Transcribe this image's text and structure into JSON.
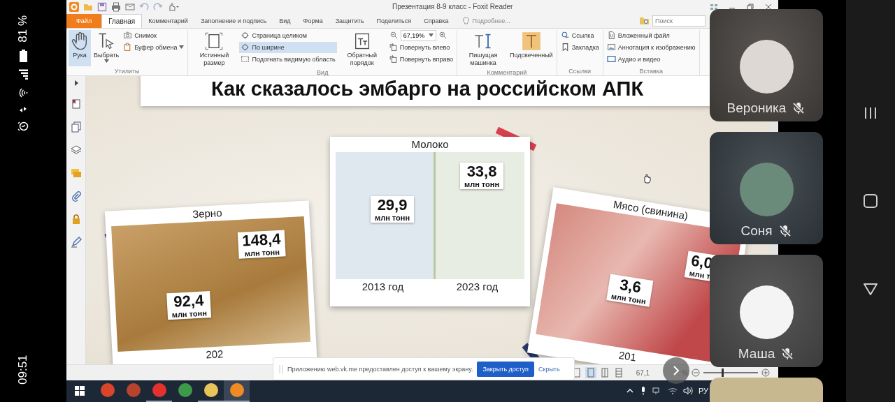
{
  "phone_status": {
    "battery": "81 %",
    "time": "09:51"
  },
  "window": {
    "title": "Презентация 8-9 класс - Foxit Reader"
  },
  "tabs": [
    {
      "kind": "file",
      "label": "Файл",
      "selected": false
    },
    {
      "kind": "tab",
      "label": "Главная",
      "selected": true
    },
    {
      "kind": "tab",
      "label": "Комментарий",
      "selected": false
    },
    {
      "kind": "tab",
      "label": "Заполнение и подпись",
      "selected": false
    },
    {
      "kind": "tab",
      "label": "Вид",
      "selected": false
    },
    {
      "kind": "tab",
      "label": "Форма",
      "selected": false
    },
    {
      "kind": "tab",
      "label": "Защитить",
      "selected": false
    },
    {
      "kind": "tab",
      "label": "Поделиться",
      "selected": false
    },
    {
      "kind": "tab",
      "label": "Справка",
      "selected": false
    }
  ],
  "tell_me": "Подробнее...",
  "search": {
    "placeholder": "Поиск"
  },
  "ribbon": [
    {
      "label": "Утилиты",
      "columns": [
        [
          {
            "kind": "large",
            "label": "Рука",
            "selected": true,
            "dropdown": false
          }
        ],
        [
          {
            "kind": "large",
            "label": "Выбрать",
            "selected": false,
            "dropdown": true
          }
        ],
        [
          {
            "kind": "small",
            "label": "Снимок",
            "selected": false,
            "dropdown": false
          },
          {
            "kind": "small",
            "label": "Буфер обмена",
            "selected": false,
            "dropdown": true
          }
        ]
      ]
    },
    {
      "label": "Вид",
      "columns": [
        [
          {
            "kind": "large",
            "label": "Истинный размер",
            "selected": false,
            "dropdown": false
          }
        ],
        [
          {
            "kind": "small",
            "label": "Страница целиком",
            "selected": false,
            "dropdown": false
          },
          {
            "kind": "small",
            "label": "По ширине",
            "selected": true,
            "dropdown": false
          },
          {
            "kind": "small",
            "label": "Подогнать видимую область",
            "selected": false,
            "dropdown": false
          }
        ],
        [
          {
            "kind": "large",
            "label": "Обратный порядок",
            "selected": false,
            "dropdown": false
          }
        ],
        [
          {
            "kind": "zoom",
            "value": "67,19%"
          },
          {
            "kind": "small",
            "label": "Повернуть влево",
            "selected": false,
            "dropdown": false
          },
          {
            "kind": "small",
            "label": "Повернуть вправо",
            "selected": false,
            "dropdown": false
          }
        ]
      ]
    },
    {
      "label": "Комментарий",
      "columns": [
        [
          {
            "kind": "large",
            "label": "Пишущая машинка",
            "selected": false,
            "dropdown": false
          }
        ],
        [
          {
            "kind": "large",
            "label": "Подсвеченный",
            "selected": false,
            "dropdown": false
          }
        ]
      ]
    },
    {
      "label": "Ссылки",
      "columns": [
        [
          {
            "kind": "small",
            "label": "Ссылка",
            "selected": false,
            "dropdown": false
          },
          {
            "kind": "small",
            "label": "Закладка",
            "selected": false,
            "dropdown": false
          }
        ]
      ]
    },
    {
      "label": "Вставка",
      "columns": [
        [
          {
            "kind": "small",
            "label": "Вложенный файл",
            "selected": false,
            "dropdown": false
          },
          {
            "kind": "small",
            "label": "Аннотация к изображению",
            "selected": false,
            "dropdown": false
          },
          {
            "kind": "small",
            "label": "Аудио и видео",
            "selected": false,
            "dropdown": false
          }
        ]
      ]
    }
  ],
  "slide": {
    "title": "Как сказалось эмбарго на российском АПК",
    "cards": [
      {
        "title": "Зерно",
        "tags": [
          {
            "value": "148,4",
            "unit": "млн тонн"
          },
          {
            "value": "92,4",
            "unit": "млн тонн"
          }
        ],
        "years": [
          "202"
        ]
      },
      {
        "title": "Молоко",
        "tags": [
          {
            "value": "33,8",
            "unit": "млн тонн"
          },
          {
            "value": "29,9",
            "unit": "млн тонн"
          }
        ],
        "years": [
          "2013 год",
          "2023 год"
        ]
      },
      {
        "title": "Мясо (свинина)",
        "tags": [
          {
            "value": "6,0",
            "unit": "млн т"
          },
          {
            "value": "3,6",
            "unit": "млн тонн"
          }
        ],
        "years": [
          "201"
        ]
      }
    ]
  },
  "doc_status": {
    "view_modes": [
      {
        "selected": false
      },
      {
        "selected": true
      },
      {
        "selected": false
      },
      {
        "selected": false
      }
    ],
    "zoom": "67,1",
    "zoom_suffix": "%",
    "level": 0.35
  },
  "share_notice": {
    "text": "Приложению web.vk.me предоставлен доступ к вашему экрану.",
    "button": "Закрыть доступ",
    "link": "Скрыть"
  },
  "taskbar": {
    "apps": [
      {
        "running": false,
        "selected": false
      },
      {
        "running": false,
        "selected": false
      },
      {
        "running": true,
        "selected": false
      },
      {
        "running": false,
        "selected": false
      },
      {
        "running": true,
        "selected": false
      },
      {
        "running": true,
        "selected": true
      }
    ],
    "language": "РУ"
  },
  "participants": [
    {
      "name": "Вероника",
      "muted": true
    },
    {
      "name": "Соня",
      "muted": true
    },
    {
      "name": "Маша",
      "muted": true
    }
  ]
}
